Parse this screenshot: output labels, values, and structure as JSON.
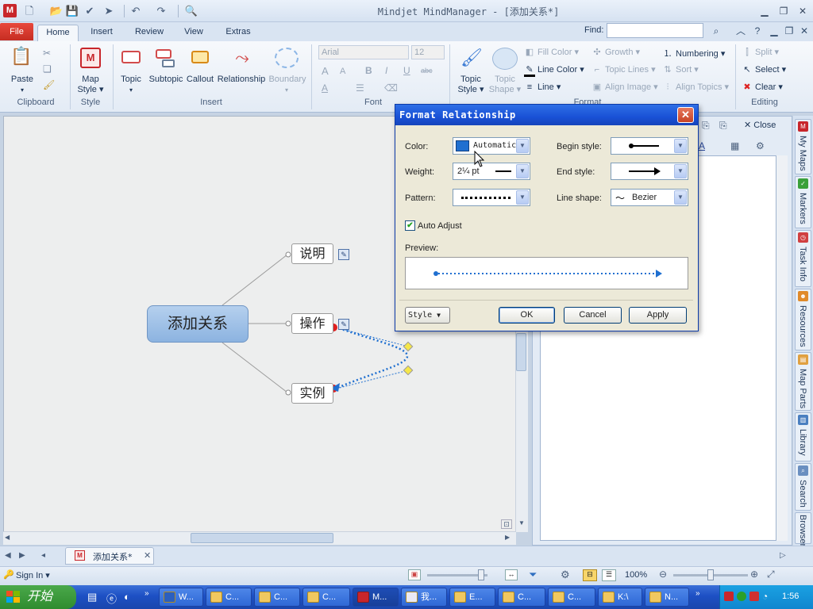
{
  "app": {
    "window_title": "Mindjet MindManager - [添加关系*]",
    "logo_text": "M"
  },
  "quick_access": {
    "icons": [
      "new-doc-icon",
      "open-folder-icon",
      "save-icon",
      "check-save-icon",
      "send-icon",
      "undo-icon",
      "redo-icon",
      "print-preview-icon"
    ]
  },
  "tabs": [
    "File",
    "Home",
    "Insert",
    "Review",
    "View",
    "Extras"
  ],
  "active_tab": "Home",
  "find": {
    "label": "Find:",
    "value": ""
  },
  "ribbon": {
    "clipboard": {
      "label": "Clipboard",
      "paste": "Paste"
    },
    "style": {
      "label": "Style",
      "map_style_line1": "Map",
      "map_style_line2": "Style ▾"
    },
    "insert": {
      "label": "Insert",
      "topic": "Topic",
      "subtopic": "Subtopic",
      "callout": "Callout",
      "relationship": "Relationship",
      "boundary": "Boundary"
    },
    "font": {
      "label": "Font",
      "font_name": "Arial",
      "font_size": "12",
      "bold": "B",
      "italic": "I",
      "underline": "U"
    },
    "format": {
      "label": "Format",
      "topic_style_line1": "Topic",
      "topic_style_line2": "Style ▾",
      "topic_shape_line1": "Topic",
      "topic_shape_line2": "Shape ▾",
      "fill_color": "Fill Color",
      "line_color": "Line Color",
      "line": "Line",
      "growth": "Growth",
      "topic_lines": "Topic Lines",
      "align_image": "Align Image",
      "numbering": "Numbering",
      "sort": "Sort",
      "align_topics": "Align Topics"
    },
    "editing": {
      "label": "Editing",
      "split": "Split",
      "select": "Select",
      "clear": "Clear"
    }
  },
  "mindmap": {
    "central": "添加关系",
    "subtopics": [
      "说明",
      "操作",
      "实例"
    ]
  },
  "right_panel": {
    "close_label": "Close"
  },
  "side_tabs": [
    "My Maps",
    "Markers",
    "Task Info",
    "Resources",
    "Map Parts",
    "Library",
    "Search",
    "Browser"
  ],
  "doc_tab": {
    "title": "添加关系*"
  },
  "statusbar": {
    "signin": "Sign In",
    "zoom": "100%"
  },
  "taskbar": {
    "start": "开始",
    "items": [
      "W...",
      "C...",
      "C...",
      "C...",
      "M...",
      "我...",
      "E...",
      "C...",
      "C...",
      "K:\\",
      "N..."
    ],
    "clock": "1:56"
  },
  "dialog": {
    "title": "Format Relationship",
    "close_glyph": "✕",
    "color_label": "Color:",
    "color_value": "Automatic",
    "color_swatch": "#1f6fd0",
    "weight_label": "Weight:",
    "weight_value": "2¼ pt",
    "pattern_label": "Pattern:",
    "begin_style_label": "Begin style:",
    "end_style_label": "End style:",
    "line_shape_label": "Line shape:",
    "line_shape_value": "Bezier",
    "auto_adjust_label": "Auto Adjust",
    "auto_adjust_checked": true,
    "preview_label": "Preview:",
    "style_button": "Style",
    "ok": "OK",
    "cancel": "Cancel",
    "apply": "Apply"
  },
  "colors": {
    "accent": "#1f6fd0",
    "titlebar": "#1951d6",
    "relationship": "#1f6fd0"
  }
}
